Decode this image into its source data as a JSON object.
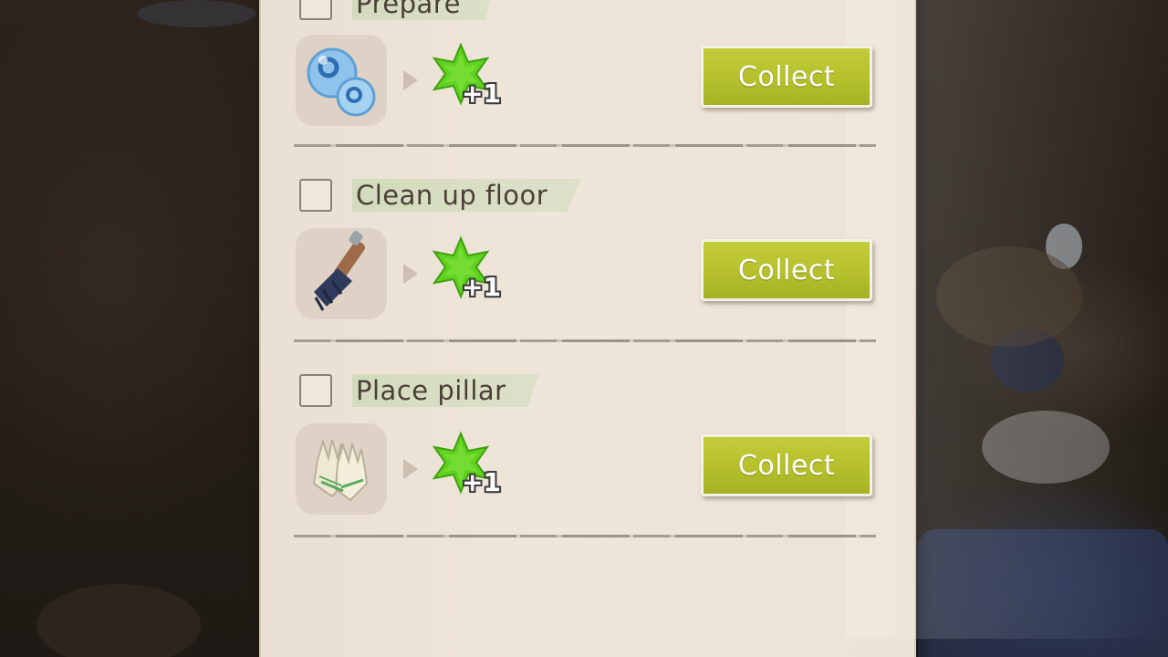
{
  "tasks": [
    {
      "title": "Prepare",
      "item_icon": "oxygen-bubbles-icon",
      "reward_icon": "green-star-icon",
      "reward_amount": "+1",
      "button_label": "Collect"
    },
    {
      "title": "Clean up floor",
      "item_icon": "brush-icon",
      "reward_icon": "green-star-icon",
      "reward_amount": "+1",
      "button_label": "Collect"
    },
    {
      "title": "Place pillar",
      "item_icon": "gloves-icon",
      "reward_icon": "green-star-icon",
      "reward_amount": "+1",
      "button_label": "Collect"
    }
  ],
  "colors": {
    "panel": "#ece2d5",
    "button": "#b5c02c",
    "title_highlight": "#bed6aa",
    "star": "#5fd11f"
  }
}
